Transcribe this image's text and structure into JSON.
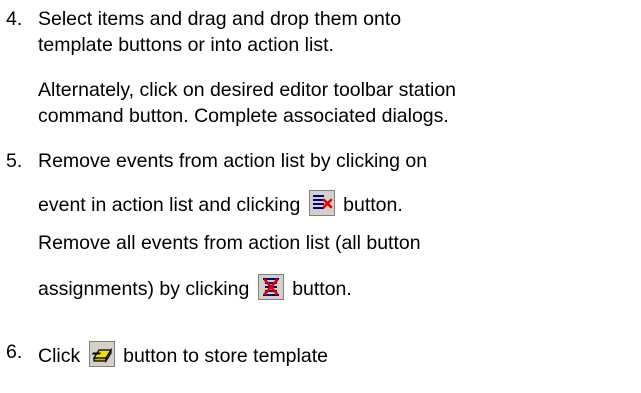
{
  "steps": [
    {
      "number": "4.",
      "lines": [
        "Select items and drag and drop them onto",
        "template buttons or into action list."
      ],
      "note": [
        "Alternately, click on desired editor toolbar station",
        "command button. Complete associated dialogs."
      ]
    },
    {
      "number": "5.",
      "lines": [
        "Remove events from action list by clicking on"
      ],
      "line2_before": "event in action list and clicking",
      "line2_after": "button.",
      "note_line1": "Remove all events from action list (all button",
      "note_line2_before": "assignments) by clicking",
      "note_line2_after": "button."
    },
    {
      "number": "6.",
      "before": "Click",
      "after": "button to store template"
    }
  ],
  "icons": {
    "remove_event": "remove-event-icon",
    "remove_all": "remove-all-icon",
    "store_template": "store-template-icon"
  }
}
